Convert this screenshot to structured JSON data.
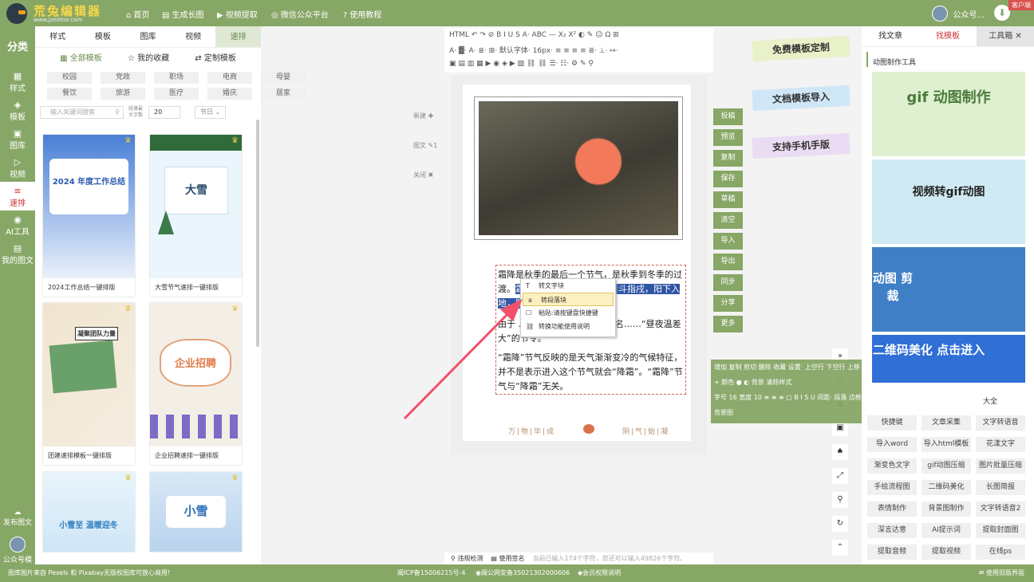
{
  "header": {
    "brand": "荒兔编辑器",
    "brand_sub": "www.jzeditor.com",
    "nav": [
      {
        "icon": "⌂",
        "label": "首页"
      },
      {
        "icon": "▤",
        "label": "生成长图"
      },
      {
        "icon": "▶",
        "label": "视频提取"
      },
      {
        "icon": "◎",
        "label": "微信公众平台"
      },
      {
        "icon": "?",
        "label": "使用教程"
      }
    ],
    "account": "公众号...",
    "client": "客户端"
  },
  "left_nav": {
    "title": "分类",
    "items": [
      {
        "icon": "▦",
        "label": "样式"
      },
      {
        "icon": "◈",
        "label": "模板"
      },
      {
        "icon": "▣",
        "label": "图库"
      },
      {
        "icon": "▷",
        "label": "视频"
      },
      {
        "icon": "≡",
        "label": "速排"
      },
      {
        "icon": "◉",
        "label": "AI工具"
      },
      {
        "icon": "▤",
        "label": "我的图文"
      }
    ],
    "publish": "发布图文",
    "account": "公众号模板"
  },
  "panel": {
    "tabs": [
      "样式",
      "模板",
      "图库",
      "视频",
      "速排"
    ],
    "subtabs": [
      "全部模板",
      "我的收藏",
      "定制模板"
    ],
    "tags": [
      "校园",
      "党政",
      "职场",
      "电商",
      "母婴",
      "餐饮",
      "旅游",
      "医疗",
      "婚庆",
      "居家"
    ],
    "search_placeholder": "输入关键词搜索",
    "count_label": "段落最大字数",
    "count_value": "20",
    "filter": "节日"
  },
  "cards": [
    {
      "caption": "2024工作总结一键排版",
      "thumb_title": "2024 年度工作总结"
    },
    {
      "caption": "大雪节气速排一键排版",
      "thumb_title": "大雪"
    },
    {
      "caption": "团建速排模板一键排版",
      "thumb_title": "凝聚团队力量"
    },
    {
      "caption": "企业招聘速排一键排版",
      "thumb_title": "企业招聘"
    },
    {
      "caption": "",
      "thumb_title": "小雪至 温暖迎冬"
    },
    {
      "caption": "",
      "thumb_title": "小雪"
    }
  ],
  "side_ops": [
    "新建",
    "图文",
    "关闭"
  ],
  "toolbar": {
    "row1": "HTML ↶ ↷ ⊘ B I U S A· ABC — X₂ X² ◐ ✎ ☺ Ω ⊞",
    "row2": "A· ▓· A· ≣· ⊞· 默认字体· 16px· ≡ ≡ ≡ ≡ ≣· ⊥· ↦·",
    "row3": "▣ ▤ ▥ ▦ ▶ ◉ ◈ ▶ ▧ ⛓ ⛓ ☰· ☷· ⚙ ✎ ⚲"
  },
  "article": {
    "p1_pre": "霜降是秋季的最后一个节气，是秋季到冬季的过渡。",
    "p1_hl": "霜降 节气，黄经达210°，斗指戌，阳下入地，阴气",
    "p1_post": "",
    "p2": "由于 ……的表现，故以“霜”命名……“昼夜温差大”的节令。",
    "p3": "“霜降”节气反映的是天气渐渐变冷的气候特征，并不是表示进入这个节气就会“降霜”。“霜降”节气与“降霜”无关。",
    "footer_left": "万|物|毕|成",
    "footer_right": "阴|气|始|凝"
  },
  "context_menu": [
    {
      "icon": "T",
      "label": "转文字块"
    },
    {
      "icon": "a",
      "label": "转段落块"
    },
    {
      "icon": "☐",
      "label": "粘贴:请按键盘快捷键"
    },
    {
      "icon": "⛓",
      "label": "转换功能使用说明"
    }
  ],
  "status": {
    "check": "违规检测",
    "sign": "使用签名",
    "count_text": "当前已输入174个字符，您还可以输入49826个字符。"
  },
  "action_buttons": [
    "投稿",
    "预览",
    "复制",
    "保存",
    "草稿",
    "清空",
    "导入",
    "导出",
    "同步",
    "分享",
    "更多"
  ],
  "stickers": [
    "免费模板定制",
    "文档模板导入",
    "支持手机手版"
  ],
  "float_bar": {
    "row1": "增加 复制 剪切 删除 收藏 设置· 上空行 下空行 上移 下移",
    "row2": "+ 颜色 ● ◐  背景 清除样式",
    "row3": "字号 16  宽度 10  ≡ ≡ ≡ ▢  B I S U  间距· 段落 边框·",
    "row4": "背景图"
  },
  "mid_icons": [
    "»",
    "▤",
    "▦",
    "▣",
    "♠",
    "⤢",
    "⚲",
    "↻",
    "⌃"
  ],
  "right_panel": {
    "tabs": [
      "找文章",
      "找模板",
      "工具箱"
    ],
    "section": "动图制作工具",
    "ads": [
      "gif 动图制作",
      "视频转gif动图",
      "动图 剪裁",
      "二维码美化 点击进入"
    ],
    "tools": [
      "快捷键",
      "文章采集",
      "文字转语音",
      "导入word",
      "导入html模板",
      "花漾文字",
      "渐变色文字",
      "gif动图压缩",
      "图片批量压缩",
      "手绘流程图",
      "二维码美化",
      "长图简报",
      "表情制作",
      "背景图制作",
      "文字转语音2",
      "深言达意",
      "AI提示词",
      "提取封面图",
      "提取音频",
      "提取视频",
      "在线ps"
    ],
    "all_label": "大全"
  },
  "bottom": {
    "left": "图库图片来自 Pexels 和 Pixabay无版权图库可放心商用!",
    "icp": "闽ICP备15006215号-4",
    "police": "闽公网安备35021302000606",
    "vip": "会员权限说明",
    "old": "使用旧版界面"
  }
}
